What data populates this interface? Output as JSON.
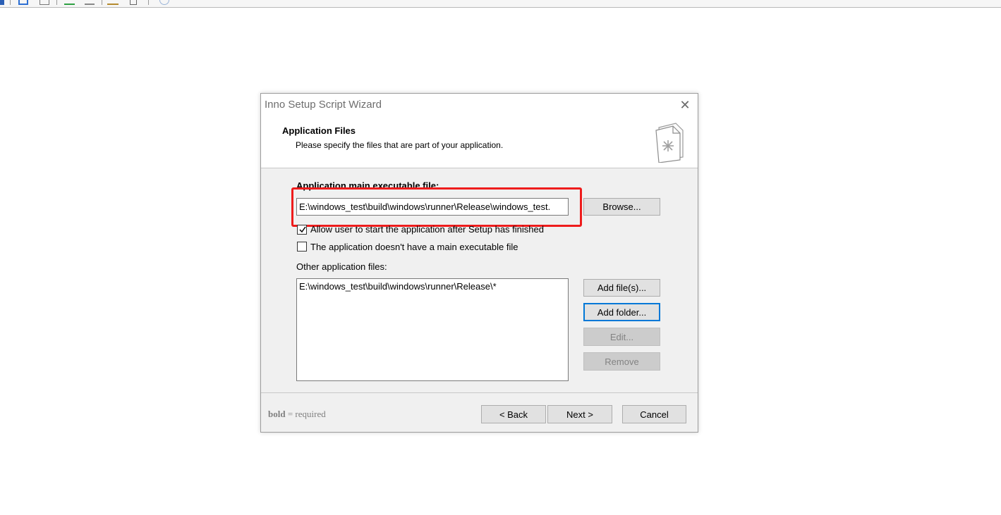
{
  "dialog": {
    "title": "Inno Setup Script Wizard",
    "close_glyph": "✕",
    "heading": "Application Files",
    "subheading": "Please specify the files that are part of your application.",
    "icon": "wizard-page-icon"
  },
  "main_exe": {
    "label": "Application main executable file:",
    "value": "E:\\windows_test\\build\\windows\\runner\\Release\\windows_test.",
    "browse_label": "Browse..."
  },
  "options": {
    "allow_start": {
      "label": "Allow user to start the application after Setup has finished",
      "checked": true
    },
    "no_main_exe": {
      "label": "The application doesn't have a main executable file",
      "checked": false
    }
  },
  "other_files": {
    "label": "Other application files:",
    "items": [
      "E:\\windows_test\\build\\windows\\runner\\Release\\*"
    ],
    "add_files_label": "Add file(s)...",
    "add_folder_label": "Add folder...",
    "edit_label": "Edit...",
    "remove_label": "Remove"
  },
  "footer": {
    "hint_bold": "bold",
    "hint_rest": " = required",
    "back_label": "< Back",
    "next_label": "Next >",
    "cancel_label": "Cancel"
  },
  "colors": {
    "highlight": "#ee1c1c",
    "focus_border": "#0078d7",
    "dialog_bg": "#f0f0f0"
  }
}
